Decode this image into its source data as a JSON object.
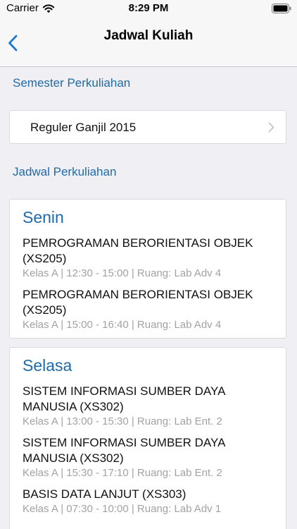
{
  "status_bar": {
    "carrier": "Carrier",
    "time": "8:29 PM"
  },
  "nav": {
    "title": "Jadwal Kuliah"
  },
  "semester_section": {
    "header": "Semester Perkuliahan",
    "selected": "Reguler Ganjil 2015"
  },
  "schedule_section": {
    "header": "Jadwal Perkuliahan"
  },
  "days": [
    {
      "name": "Senin",
      "courses": [
        {
          "name": "PEMROGRAMAN BERORIENTASI OBJEK (XS205)",
          "meta": "Kelas A | 12:30 - 15:00 | Ruang: Lab Adv 4"
        },
        {
          "name": "PEMROGRAMAN BERORIENTASI OBJEK (XS205)",
          "meta": "Kelas A | 15:00 - 16:40 | Ruang: Lab Adv 4"
        }
      ]
    },
    {
      "name": "Selasa",
      "courses": [
        {
          "name": "SISTEM INFORMASI SUMBER DAYA MANUSIA (XS302)",
          "meta": "Kelas A | 13:00 - 15:30 | Ruang: Lab Ent. 2"
        },
        {
          "name": "SISTEM INFORMASI SUMBER DAYA MANUSIA (XS302)",
          "meta": "Kelas A | 15:30 - 17:10 | Ruang: Lab Ent. 2"
        },
        {
          "name": "BASIS DATA LANJUT (XS303)",
          "meta": "Kelas A | 07:30 - 10:00 | Ruang: Lab Adv 1"
        }
      ]
    }
  ],
  "colors": {
    "accent": "#1f6aa8",
    "background": "#efeff4",
    "card": "#ffffff",
    "meta_text": "#a2a2a6"
  },
  "icons": {
    "wifi": "wifi-icon",
    "battery": "battery-icon",
    "back": "chevron-left-icon",
    "selector": "chevron-right-icon"
  }
}
